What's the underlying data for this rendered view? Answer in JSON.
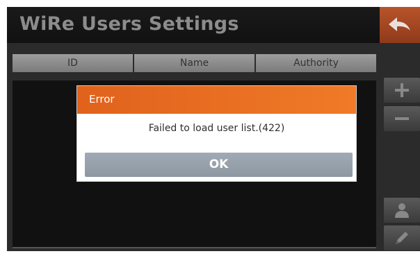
{
  "header": {
    "title": "WiRe Users Settings"
  },
  "table": {
    "columns": [
      "ID",
      "Name",
      "Authority"
    ]
  },
  "dialog": {
    "title": "Error",
    "message": "Failed to load user list.(422)",
    "ok_label": "OK"
  },
  "icons": {
    "back": "back-arrow-icon",
    "add": "plus-icon",
    "remove": "minus-icon",
    "user": "user-icon",
    "edit": "pencil-icon"
  },
  "colors": {
    "accent": "#e0621c",
    "back_button": "#a4481f",
    "ok_button": "#97a1ab"
  }
}
